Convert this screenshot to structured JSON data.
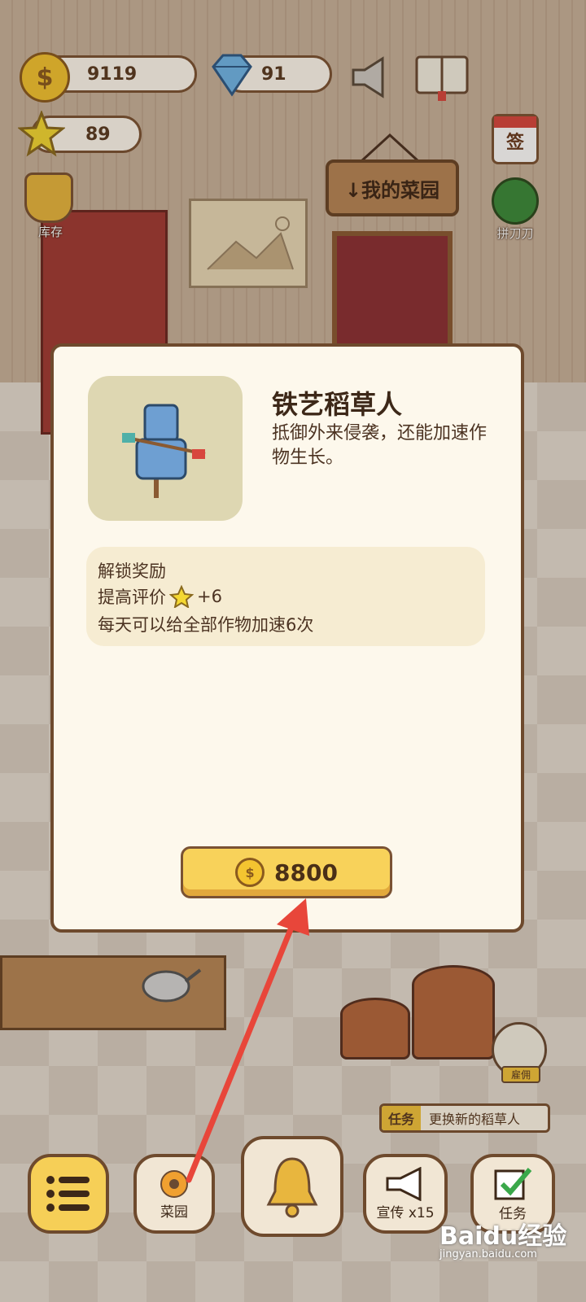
{
  "hud": {
    "coins": "9119",
    "diamonds": "91",
    "stars": "89"
  },
  "scene": {
    "sign_label": "↓我的菜园",
    "inventory_label": "库存",
    "checkin_label": "签",
    "pinduoduo_label": "拼刀刀",
    "hire_label": "雇佣"
  },
  "modal": {
    "title": "铁艺稻草人",
    "description": "抵御外来侵袭，还能加速作物生长。",
    "reward_heading": "解锁奖励",
    "reward_rating_label": "提高评价",
    "reward_rating_value": "+6",
    "reward_speedup": "每天可以给全部作物加速6次",
    "price": "8800"
  },
  "task_banner": {
    "tag": "任务",
    "text": "更换新的稻草人"
  },
  "bottom_bar": {
    "garden_label": "菜园",
    "promote_label": "宣传 x15",
    "task_label": "任务"
  },
  "watermark": {
    "brand": "Baidu经验",
    "url": "jingyan.baidu.com"
  },
  "colors": {
    "accent": "#f8d25a",
    "outline": "#6e4a2d",
    "arrow": "#e8463a"
  }
}
